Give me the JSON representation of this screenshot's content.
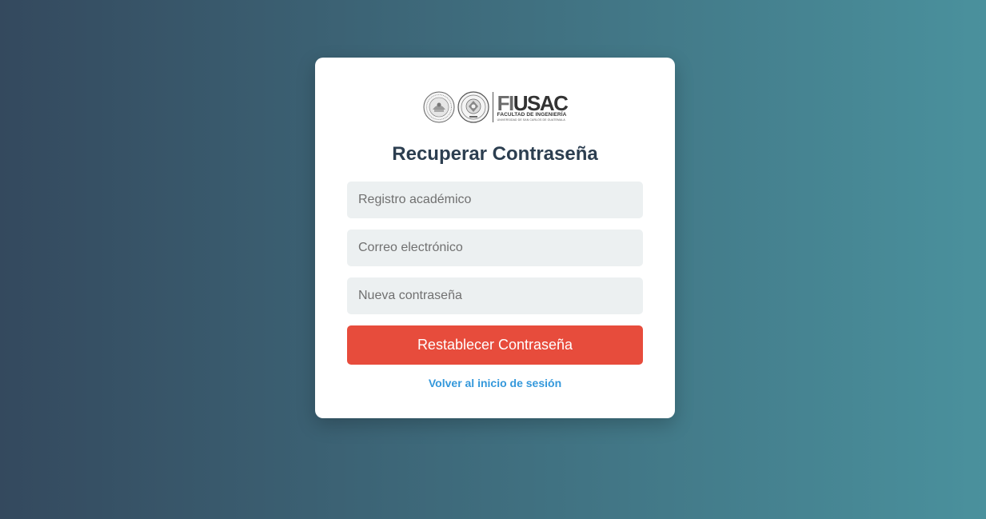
{
  "colors": {
    "background_start": "#34495e",
    "background_end": "#4a919d",
    "card": "#ffffff",
    "title": "#2c3e50",
    "input_background": "#ecf0f1",
    "button": "#e74c3c",
    "link": "#3498db"
  },
  "logo": {
    "seals": [
      "usac-seal-icon",
      "engineering-seal-icon"
    ],
    "brand_fi": "FI",
    "brand_usac": "USAC",
    "subtitle": "FACULTAD DE INGENIERÍA",
    "university": "UNIVERSIDAD DE SAN CARLOS DE GUATEMALA"
  },
  "page": {
    "title": "Recuperar Contraseña"
  },
  "form": {
    "registro": {
      "placeholder": "Registro académico",
      "value": ""
    },
    "correo": {
      "placeholder": "Correo electrónico",
      "value": ""
    },
    "password": {
      "placeholder": "Nueva contraseña",
      "value": ""
    },
    "submit_label": "Restablecer Contraseña",
    "back_link": "Volver al inicio de sesión"
  }
}
